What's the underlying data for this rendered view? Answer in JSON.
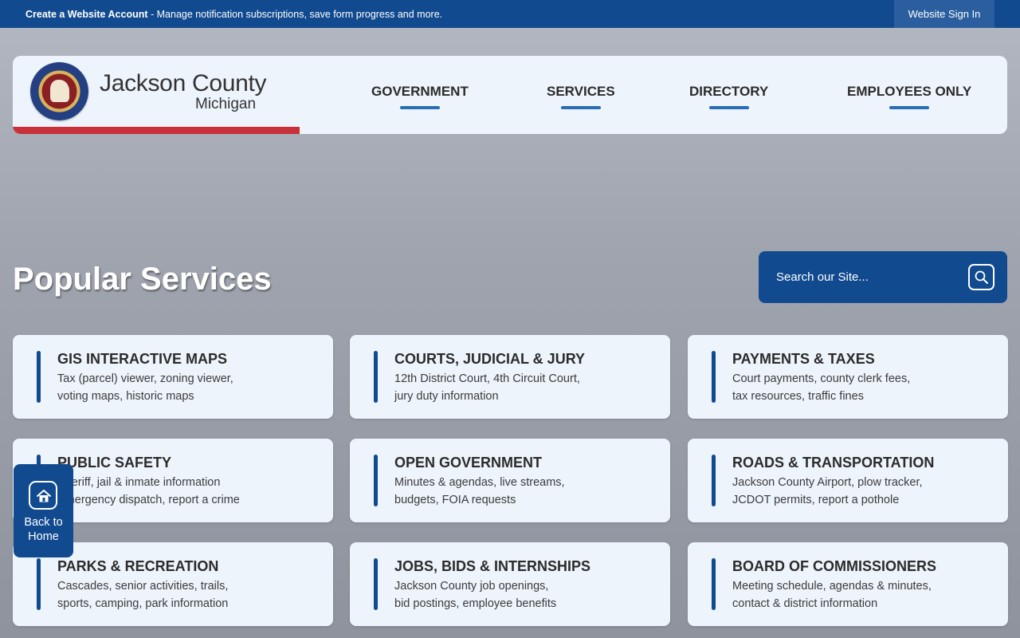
{
  "topbar": {
    "promo_bold": "Create a Website Account",
    "promo_text": " - Manage notification subscriptions, save form progress and more.",
    "signin": "Website Sign In"
  },
  "brand": {
    "name": "Jackson County",
    "sub": "Michigan"
  },
  "nav": {
    "government": "GOVERNMENT",
    "services": "SERVICES",
    "directory": "DIRECTORY",
    "employees": "EMPLOYEES ONLY"
  },
  "heading": "Popular Services",
  "search": {
    "placeholder": "Search our Site..."
  },
  "cards": [
    {
      "title": "GIS INTERACTIVE MAPS",
      "line1": "Tax (parcel) viewer, zoning viewer,",
      "line2": "voting maps, historic maps"
    },
    {
      "title": "COURTS, JUDICIAL & JURY",
      "line1": "12th District Court, 4th Circuit Court,",
      "line2": "jury duty information"
    },
    {
      "title": "PAYMENTS & TAXES",
      "line1": "Court payments, county clerk fees,",
      "line2": "tax resources, traffic fines"
    },
    {
      "title": "PUBLIC SAFETY",
      "line1": "Sheriff, jail & inmate information",
      "line2": "Emergency dispatch, report a crime"
    },
    {
      "title": "OPEN GOVERNMENT",
      "line1": "Minutes & agendas, live streams,",
      "line2": "budgets, FOIA requests"
    },
    {
      "title": "ROADS & TRANSPORTATION",
      "line1": "Jackson County Airport, plow tracker,",
      "line2": "JCDOT permits, report a pothole"
    },
    {
      "title": "PARKS & RECREATION",
      "line1": "Cascades, senior activities, trails,",
      "line2": "sports, camping, park information"
    },
    {
      "title": "JOBS, BIDS & INTERNSHIPS",
      "line1": "Jackson County job openings,",
      "line2": "bid postings, employee benefits"
    },
    {
      "title": "BOARD OF COMMISSIONERS",
      "line1": "Meeting schedule, agendas & minutes,",
      "line2": "contact & district information"
    }
  ],
  "home_button": {
    "line1": "Back to",
    "line2": "Home"
  },
  "icons": {
    "search": "search-icon",
    "home": "home-icon",
    "seal": "county-seal-logo"
  },
  "colors": {
    "primary": "#114a8f",
    "accent_red": "#c8303a",
    "nav_underline": "#2a6db5",
    "card_bg": "#eef4fc"
  }
}
